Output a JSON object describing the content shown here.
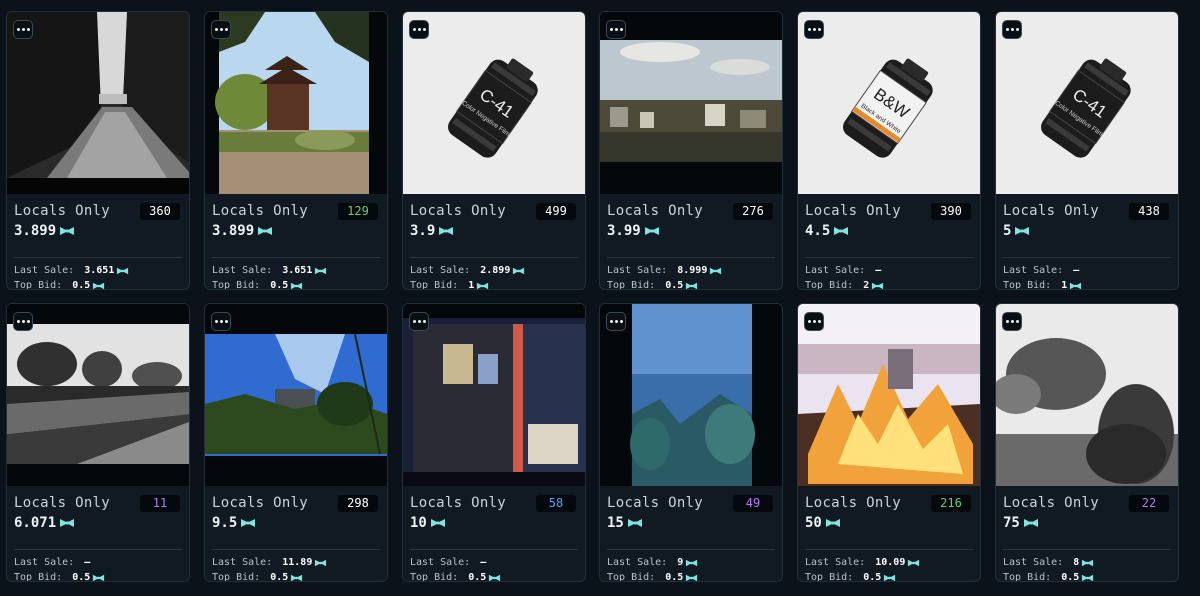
{
  "accent_color": "#7fe3e0",
  "labels": {
    "last_sale": "Last Sale:",
    "top_bid": "Top Bid:"
  },
  "icons": {
    "menu": "ellipsis-icon",
    "currency": "bowtie-icon"
  },
  "cards": [
    {
      "title": "Locals Only",
      "badge": "360",
      "badge_color": "#ffffff",
      "price": "3.899",
      "last_sale": "3.651",
      "top_bid": "0.5",
      "image": "bw-park-path"
    },
    {
      "title": "Locals Only",
      "badge": "129",
      "badge_color": "#5fd37a",
      "price": "3.899",
      "last_sale": "3.651",
      "top_bid": "0.5",
      "image": "chinese-pagoda-garden"
    },
    {
      "title": "Locals Only",
      "badge": "499",
      "badge_color": "#ffffff",
      "price": "3.9",
      "last_sale": "2.899",
      "top_bid": "1",
      "image": "film-canister",
      "canister_label": "C-41",
      "canister_sub": "Color Negative Film"
    },
    {
      "title": "Locals Only",
      "badge": "276",
      "badge_color": "#ffffff",
      "price": "3.99",
      "last_sale": "8.999",
      "top_bid": "0.5",
      "image": "city-rooftops"
    },
    {
      "title": "Locals Only",
      "badge": "390",
      "badge_color": "#ffffff",
      "price": "4.5",
      "last_sale": "–",
      "top_bid": "2",
      "image": "film-canister",
      "canister_label": "B&W",
      "canister_sub": "Black and White"
    },
    {
      "title": "Locals Only",
      "badge": "438",
      "badge_color": "#ffffff",
      "price": "5",
      "last_sale": "–",
      "top_bid": "1",
      "image": "film-canister",
      "canister_label": "C-41",
      "canister_sub": "Color Negative Film"
    },
    {
      "title": "Locals Only",
      "badge": "11",
      "badge_color": "#b57bf0",
      "price": "6.071",
      "last_sale": "–",
      "top_bid": "0.5",
      "image": "bw-riverside-walk"
    },
    {
      "title": "Locals Only",
      "badge": "298",
      "badge_color": "#ffffff",
      "price": "9.5",
      "last_sale": "11.89",
      "top_bid": "0.5",
      "image": "house-on-hill"
    },
    {
      "title": "Locals Only",
      "badge": "58",
      "badge_color": "#4aa8ff",
      "price": "10",
      "last_sale": "–",
      "top_bid": "0.5",
      "image": "double-exposure-night"
    },
    {
      "title": "Locals Only",
      "badge": "49",
      "badge_color": "#b57bf0",
      "price": "15",
      "last_sale": "9",
      "top_bid": "0.5",
      "image": "lake-blue"
    },
    {
      "title": "Locals Only",
      "badge": "216",
      "badge_color": "#5fd37a",
      "price": "50",
      "last_sale": "10.09",
      "top_bid": "0.5",
      "image": "fire-pit"
    },
    {
      "title": "Locals Only",
      "badge": "22",
      "badge_color": "#b57bf0",
      "price": "75",
      "last_sale": "8",
      "top_bid": "0.5",
      "image": "bw-bush-closeup"
    }
  ]
}
